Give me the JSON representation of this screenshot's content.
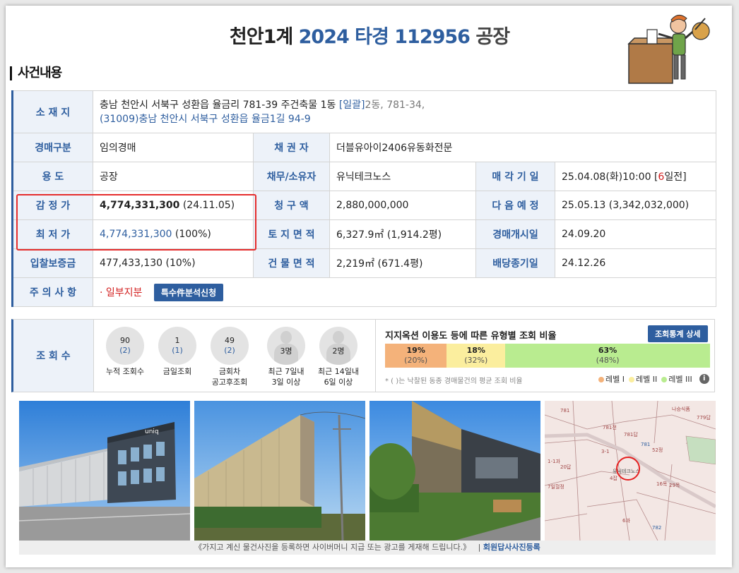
{
  "header": {
    "court": "천안1계",
    "case": "2024 타경 112956",
    "type": "공장"
  },
  "section": {
    "title": "사건내용"
  },
  "info": {
    "location_label": "소 재 지",
    "location_line1": "충남 천안시 서북구 성환읍 율금리 781-39 주건축물 1동",
    "location_bulk": "[일괄]",
    "location_extra": "2동, 781-34,",
    "location_line2": "(31009)충남 천안시 서북구  성환읍 율금1길  94-9",
    "auction_type_label": "경매구분",
    "auction_type": "임의경매",
    "creditor_label": "채 권 자",
    "creditor": "더블유아이2406유동화전문",
    "use_label": "용    도",
    "use": "공장",
    "debtor_label": "채무/소유자",
    "debtor": "유닉테크노스",
    "sale_date_label": "매 각 기 일",
    "sale_date": "25.04.08(화)10:00 [",
    "sale_days": "6",
    "sale_days_suffix": "일전]",
    "appraisal_label": "감 정 가",
    "appraisal": "4,774,331,300",
    "appraisal_date": "(24.11.05)",
    "claim_label": "청 구 액",
    "claim": "2,880,000,000",
    "next_label": "다 음 예 정",
    "next": "25.05.13 (3,342,032,000)",
    "min_label": "최 저 가",
    "min_price": "4,774,331,300",
    "min_pct": "(100%)",
    "land_label": "토 지 면 적",
    "land": "6,327.9㎡ (1,914.2평)",
    "start_label": "경매개시일",
    "start": "24.09.20",
    "deposit_label": "입찰보증금",
    "deposit": "477,433,130 (10%)",
    "building_label": "건 물 면 적",
    "building": "2,219㎡ (671.4평)",
    "dividend_label": "배당종기일",
    "dividend": "24.12.26",
    "caution_label": "주 의 사 항",
    "caution": "· 일부지분",
    "special_btn": "특수件분석신청"
  },
  "views": {
    "label": "조 회 수",
    "stats": [
      {
        "num": "90",
        "sub": "(2)",
        "cap1": "누적 조회수",
        "cap2": ""
      },
      {
        "num": "1",
        "sub": "(1)",
        "cap1": "금일조회",
        "cap2": ""
      },
      {
        "num": "49",
        "sub": "(2)",
        "cap1": "금회차",
        "cap2": "공고후조회"
      },
      {
        "num": "3명",
        "sub": "",
        "cap1": "최근 7일내",
        "cap2": "3일 이상"
      },
      {
        "num": "2명",
        "sub": "",
        "cap1": "최근 14일내",
        "cap2": "6일 이상"
      }
    ],
    "ratio_title": "지지옥션 이용도 등에 따른 유형별 조회 비율",
    "stats_btn": "조회통계 상세",
    "bars": [
      {
        "pct": "19%",
        "avg": "(20%)",
        "value": 19,
        "color": "#f4b27a"
      },
      {
        "pct": "18%",
        "avg": "(32%)",
        "value": 18,
        "color": "#fbee9e"
      },
      {
        "pct": "63%",
        "avg": "(48%)",
        "value": 63,
        "color": "#b9ec90"
      }
    ],
    "note": "* ( )는 낙찰된 동종 경매물건의 평균 조회 비율",
    "legend": [
      {
        "label": "레벨 I",
        "color": "#f4b27a"
      },
      {
        "label": "레벨 II",
        "color": "#fbee9e"
      },
      {
        "label": "레벨 III",
        "color": "#b9ec90"
      }
    ]
  },
  "photos": {
    "sign_text": "uniq",
    "map_labels": [
      "781",
      "나승식품",
      "779답",
      "781전",
      "781",
      "3-1",
      "781답",
      "52정",
      "20답",
      "유닉테크노스",
      "4잡",
      "16목",
      "29목",
      "6과",
      "782",
      "1-1과",
      "7일헐정"
    ]
  },
  "footer": {
    "text": "《가지고 계신 물건사진을 등록하면 사이버머니 지급 또는 광고를 게재해 드립니다.》",
    "sep": "|",
    "link": "회원답사사진등록"
  }
}
